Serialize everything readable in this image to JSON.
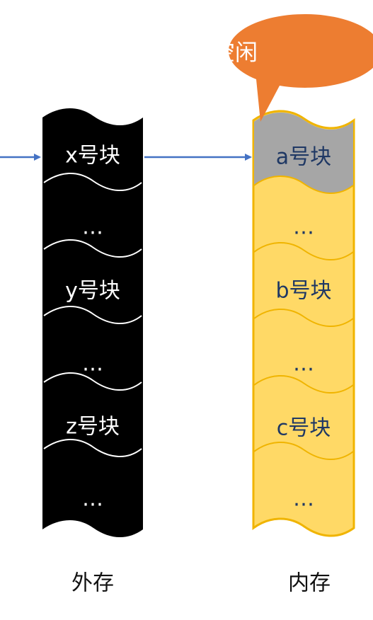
{
  "callout": {
    "label": "空闲"
  },
  "external_storage": {
    "label": "外存",
    "blocks": [
      "x号块",
      "…",
      "y号块",
      "…",
      "z号块",
      "…"
    ]
  },
  "internal_storage": {
    "label": "内存",
    "blocks": [
      "a号块",
      "…",
      "b号块",
      "…",
      "c号块",
      "…"
    ]
  },
  "colors": {
    "external_fill": "#000000",
    "internal_fill": "#ffd966",
    "internal_border": "#f0b400",
    "free_block_fill": "#a6a6a6",
    "arrow": "#4472c4",
    "callout_fill": "#ed7d31"
  }
}
